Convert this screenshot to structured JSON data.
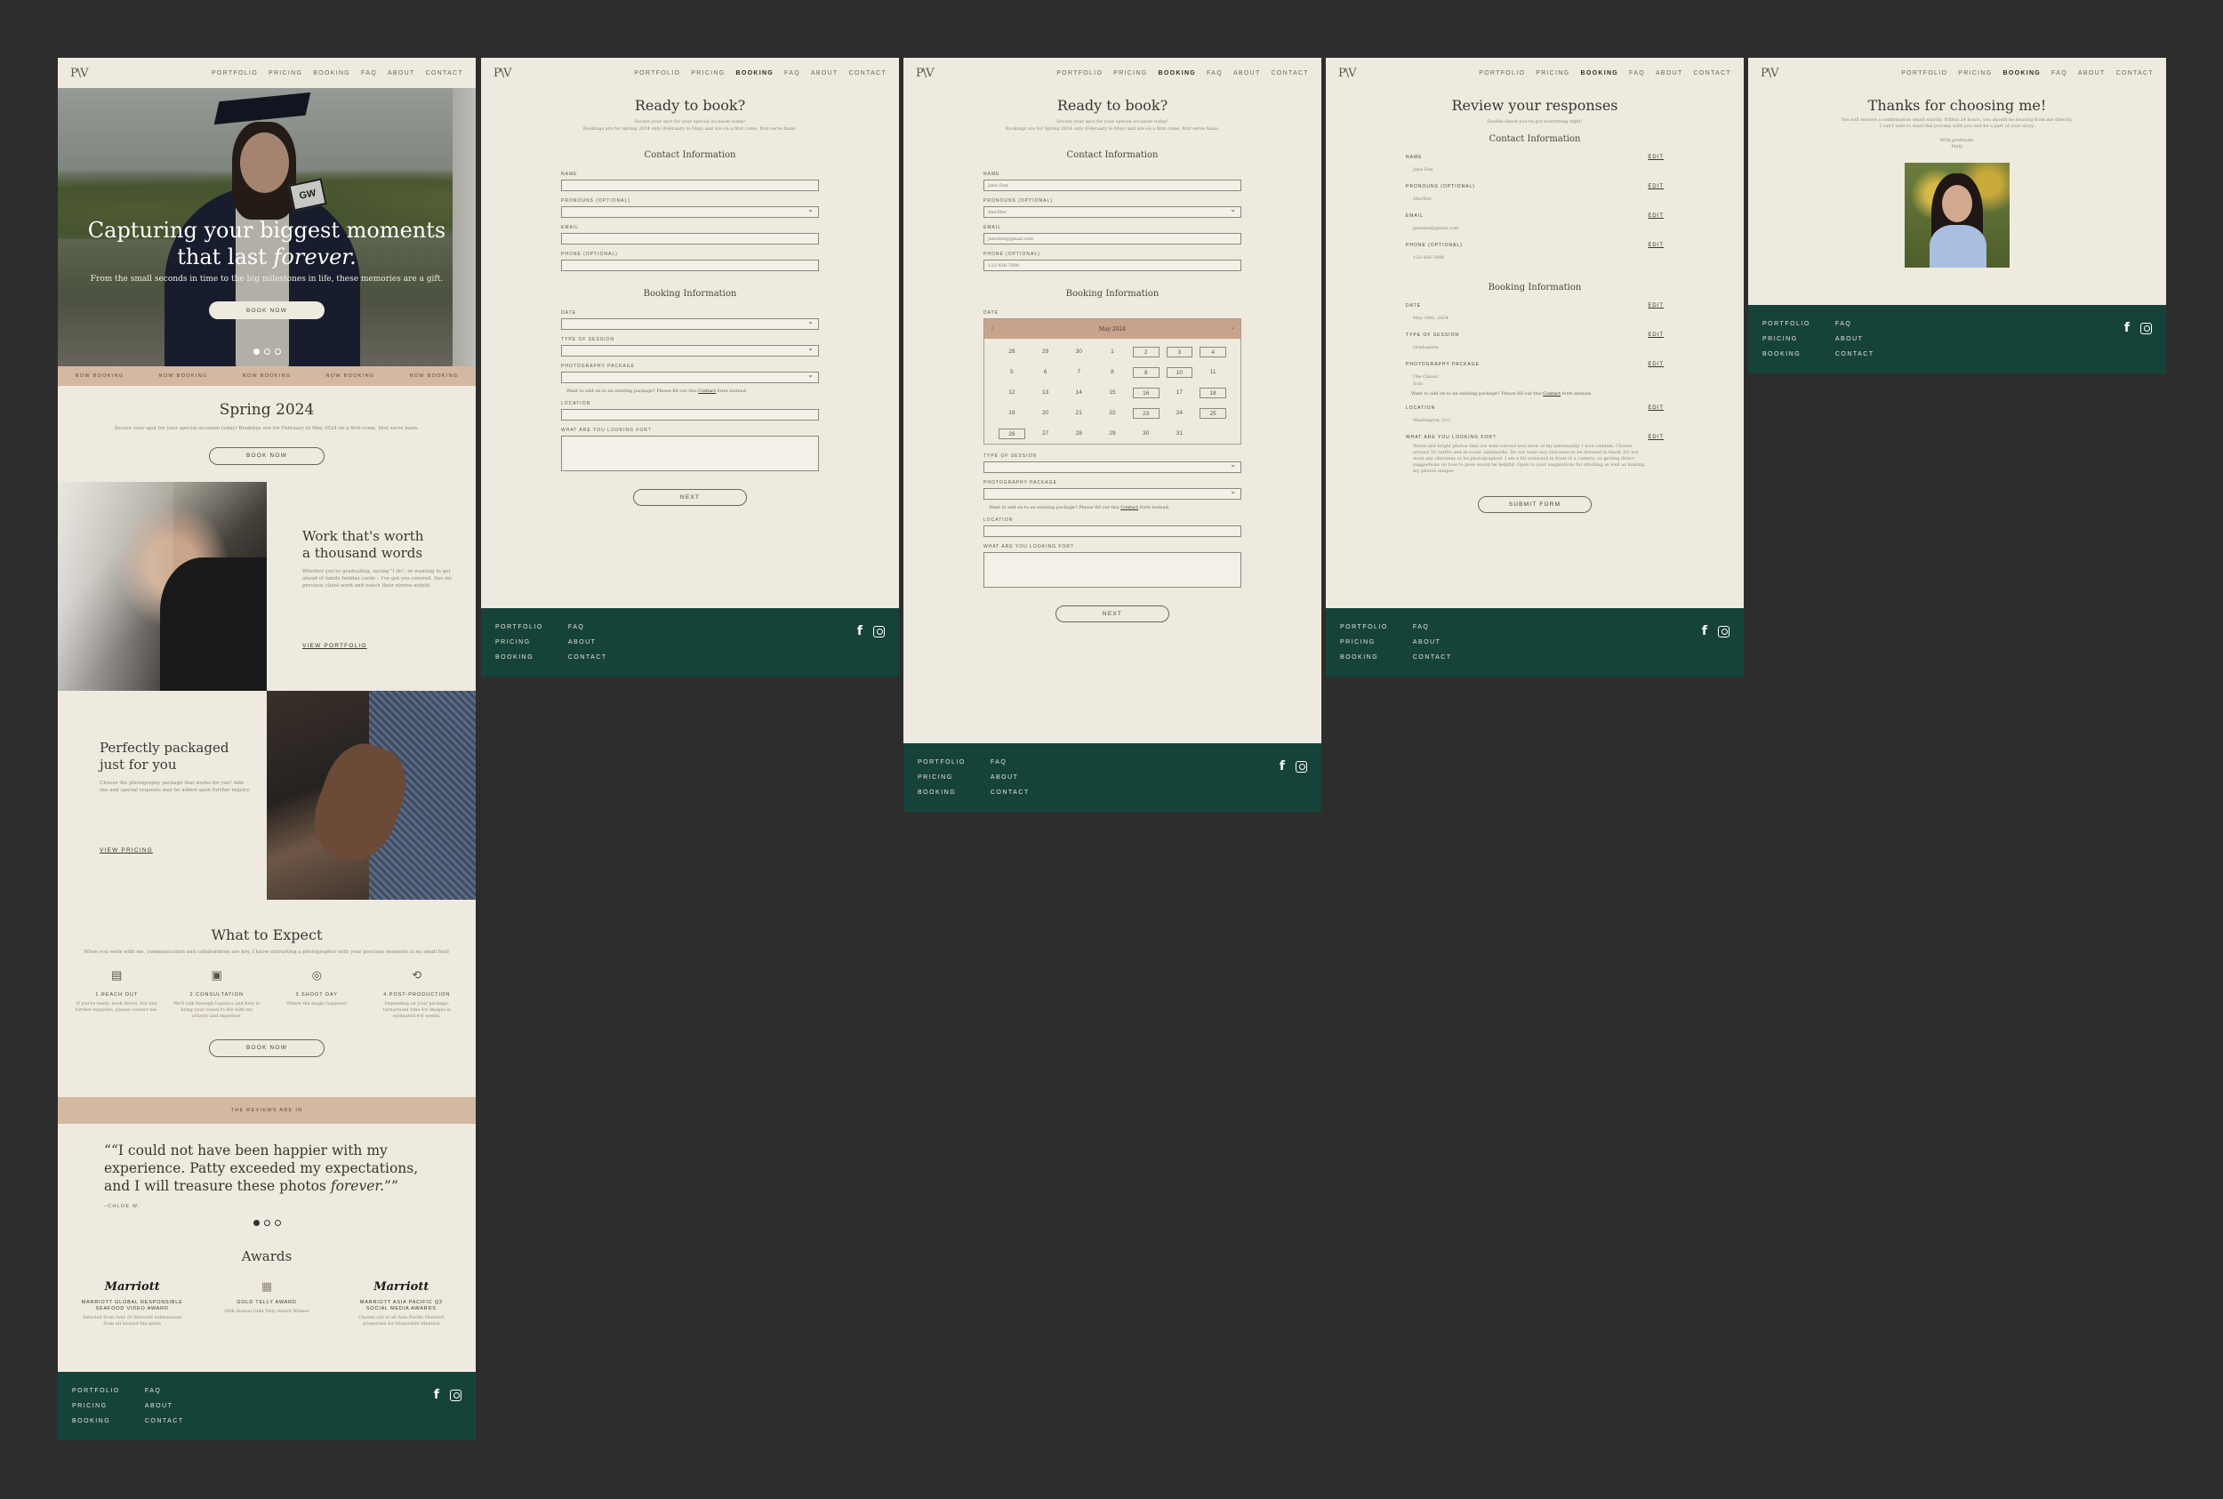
{
  "nav": {
    "logo": "P\\V",
    "items": [
      "PORTFOLIO",
      "PRICING",
      "BOOKING",
      "FAQ",
      "ABOUT",
      "CONTACT"
    ]
  },
  "footer": {
    "col1": [
      "PORTFOLIO",
      "PRICING",
      "BOOKING"
    ],
    "col2": [
      "FAQ",
      "ABOUT",
      "CONTACT"
    ]
  },
  "home": {
    "hero_title_1": "Capturing your biggest moments",
    "hero_title_2": "that last",
    "hero_title_em": "forever.",
    "hero_sub": "From the small seconds in time to the big milestones in life, these memories are a gift.",
    "hero_btn": "BOOK NOW",
    "gw": "GW",
    "marquee": [
      "NOW BOOKING",
      "NOW BOOKING",
      "NOW BOOKING",
      "NOW BOOKING",
      "NOW BOOKING"
    ],
    "spring_title": "Spring 2024",
    "spring_sub": "Secure your spot for your special occasion today! Bookings are for February to May 2024 on a first come, first serve basis.",
    "spring_btn": "BOOK NOW",
    "work_title_1": "Work that's worth",
    "work_title_2": "a thousand words",
    "work_body": "Whether you're graduating, saying \"I do\", or wanting to get ahead of family holiday cards – I've got you covered. See my previous client work and watch their stories unfold.",
    "work_link": "VIEW PORTFOLIO",
    "pack_title_1": "Perfectly packaged",
    "pack_title_2": "just for you",
    "pack_body": "Choose the photography package that works for you! Add-ons and special requests may be added upon further inquiry.",
    "pack_link": "VIEW PRICING",
    "expect_title": "What to Expect",
    "expect_sub": "When you work with me, communication and collaboration are key. I know entrusting a photographer with your precious moments is no small feat!",
    "steps": [
      {
        "icon": "▤",
        "title": "1.REACH OUT",
        "text": "If you're ready, book direct. For any further inquiries, please contact me."
      },
      {
        "icon": "▣",
        "title": "2.CONSULTATION",
        "text": "We'll talk through logistics and how to bring your vision to life with my artistry and expertise."
      },
      {
        "icon": "◎",
        "title": "3.SHOOT DAY",
        "text": "Where the magic happens!"
      },
      {
        "icon": "⟲",
        "title": "4.POST-PRODUCTION",
        "text": "Depending on your package, turnaround time for images is estimated 4-6 weeks."
      }
    ],
    "expect_btn": "BOOK NOW",
    "reviews_band": "THE REVIEWS ARE IN",
    "quote_1": "“I could not have been happier with my",
    "quote_2": "experience. Patty exceeded my expectations,",
    "quote_3": "and I will treasure these photos",
    "quote_em": "forever.",
    "quote_end": "”",
    "quote_by": "–CHLOE W.",
    "awards_title": "Awards",
    "awards": [
      {
        "logo": "Marriott",
        "title": "MARRIOTT GLOBAL RESPONSIBLE SEAFOOD VIDEO AWARD",
        "text": "Selected from over 20 Marriott submissions from all around the globe"
      },
      {
        "logo": "▦",
        "title": "GOLD TELLY AWARD",
        "text": "39th Annual Gold Telly Award Winner"
      },
      {
        "logo": "Marriott",
        "title": "MARRIOTT ASIA PACIFIC Q3 SOCIAL MEDIA AWARDS",
        "text": "Chosen out of all Asia Pacific Marriott properties for Honorable Mention"
      }
    ]
  },
  "book": {
    "title": "Ready to book?",
    "sub_1": "Secure your spot for your special occasion today!",
    "sub_2": "Bookings are for Spring 2024 only (February to May) and are on a first come, first serve basis.",
    "contact_title": "Contact Information",
    "name_label": "NAME",
    "pronouns_label": "PRONOUNS (OPTIONAL)",
    "email_label": "EMAIL",
    "phone_label": "PHONE (OPTIONAL)",
    "booking_title": "Booking Information",
    "date_label": "DATE",
    "session_label": "TYPE OF SESSION",
    "package_label": "PHOTOGRAPHY PACKAGE",
    "addon_note": "Want to add on to an existing package? Please fill out this",
    "addon_link": "Contact",
    "addon_end": "form instead.",
    "location_label": "LOCATION",
    "looking_label": "WHAT ARE YOU LOOKING FOR?",
    "next_btn": "NEXT",
    "name_val": "Jane Doe",
    "pronouns_val": "She/Her",
    "email_val": "janedoe@gmail.com",
    "phone_val": "123-456-7890",
    "month": "May 2024",
    "prev": "‹",
    "next": "›",
    "days": [
      "28",
      "29",
      "30",
      "1",
      "2",
      "3",
      "4",
      "5",
      "6",
      "7",
      "8",
      "9",
      "10",
      "11",
      "12",
      "13",
      "14",
      "15",
      "16",
      "17",
      "18",
      "19",
      "20",
      "21",
      "22",
      "23",
      "24",
      "25",
      "26",
      "27",
      "28",
      "29",
      "30",
      "31",
      ""
    ],
    "boxed": [
      4,
      5,
      6,
      11,
      12,
      18,
      20,
      25,
      27,
      28
    ]
  },
  "review": {
    "title": "Review your responses",
    "sub": "Double check you've got everything right!",
    "contact_title": "Contact Information",
    "booking_title": "Booking Information",
    "edit": "EDIT",
    "items_c": [
      {
        "label": "NAME",
        "val": "Jane Doe"
      },
      {
        "label": "PRONOUNS (OPTIONAL)",
        "val": "She/Her"
      },
      {
        "label": "EMAIL",
        "val": "janedoe@gmail.com"
      },
      {
        "label": "PHONE (OPTIONAL)",
        "val": "123-456-7890"
      }
    ],
    "items_b": [
      {
        "label": "DATE",
        "val": "May 18th, 2024"
      },
      {
        "label": "TYPE OF SESSION",
        "val": "Graduation"
      },
      {
        "label": "PHOTOGRAPHY PACKAGE",
        "val": "The Classic"
      },
      {
        "label": "LOCATION",
        "val": "Washington, D.C."
      },
      {
        "label": "WHAT ARE YOU LOOKING FOR?",
        "val": "Warm and bright photos that are well-colored and show of my personality. I love candids. Choose around 10 outfits and at iconic landmarks. Do not want any obscenes or be dressed in black. Do not want any obscenes or be photographed. I am a bit awkward in front of a camera, so getting direct suggestions on how to pose would be helpful. Open to your suggestions for strolling as well as making my photos unique."
      }
    ],
    "pkg_sub": "Solo",
    "submit": "SUBMIT FORM"
  },
  "thanks": {
    "title": "Thanks for choosing me!",
    "sub_1": "You will receive a confirmation email shortly. Within 24 hours, you should be hearing from me directly.",
    "sub_2": "I can't wait to start this journey with you and be a part of your story.",
    "sign_1": "With gratitude,",
    "sign_2": "Patty"
  }
}
